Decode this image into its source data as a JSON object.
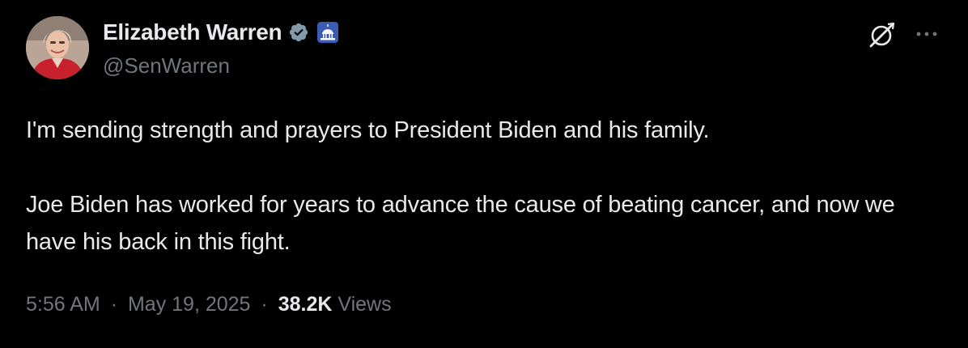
{
  "author": {
    "display_name": "Elizabeth Warren",
    "handle": "@SenWarren",
    "verified_badge_color": "#829aab",
    "affiliation_badge_icon": "capitol-building-icon"
  },
  "tweet": {
    "paragraphs": [
      "I'm sending strength and prayers to President Biden and his family.",
      "Joe Biden has worked for years to advance the cause of beating cancer, and now we have his back in this fight."
    ]
  },
  "meta": {
    "time": "5:56 AM",
    "separator": "·",
    "date": "May 19, 2025",
    "views_count": "38.2K",
    "views_label": "Views"
  },
  "colors": {
    "background": "#000000",
    "text_primary": "#e7e9ea",
    "text_secondary": "#71767b"
  }
}
